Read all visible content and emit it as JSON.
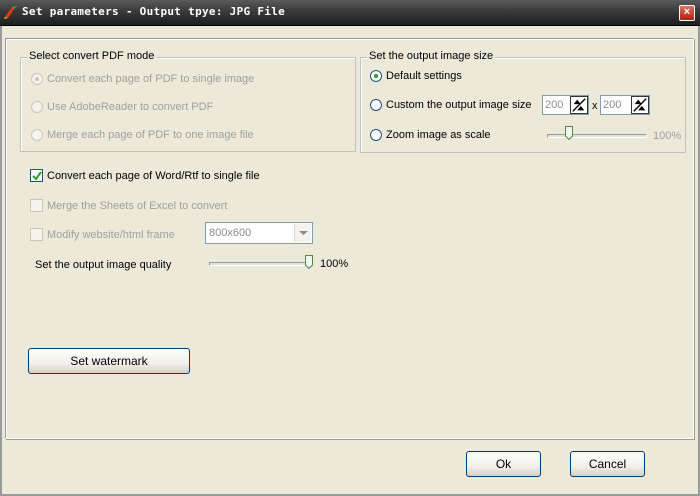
{
  "window": {
    "title": "Set parameters - Output tpye: JPG File",
    "close_glyph": "×"
  },
  "pdf_mode": {
    "legend": "Select convert PDF mode",
    "options": [
      {
        "label": "Convert each page of PDF to single image",
        "selected": true
      },
      {
        "label": "Use AdobeReader to convert PDF",
        "selected": false
      },
      {
        "label": "Merge each page of PDF to one image file",
        "selected": false
      }
    ]
  },
  "image_size": {
    "legend": "Set the output image size",
    "default_label": "Default settings",
    "custom_label": "Custom the output image size",
    "width_value": "200",
    "times": "x",
    "height_value": "200",
    "zoom_label": "Zoom image as scale",
    "zoom_value": "100%",
    "zoom_level": 0.2,
    "selected": "default"
  },
  "word_option": {
    "label": "Convert each page of Word/Rtf to single file",
    "checked": true
  },
  "excel_option": {
    "label": "Merge the Sheets of Excel to convert",
    "checked": false
  },
  "website_option": {
    "label": "Modify website/html frame",
    "checked": false,
    "frame_value": "800x600"
  },
  "quality": {
    "label": "Set the output image quality",
    "value": "100%",
    "level": 1.0
  },
  "watermark_button": "Set watermark",
  "ok_button": "Ok",
  "cancel_button": "Cancel",
  "colors": {
    "titlebar": "#2e2e2e",
    "background": "#ece9d8",
    "check_green": "#21a121"
  }
}
